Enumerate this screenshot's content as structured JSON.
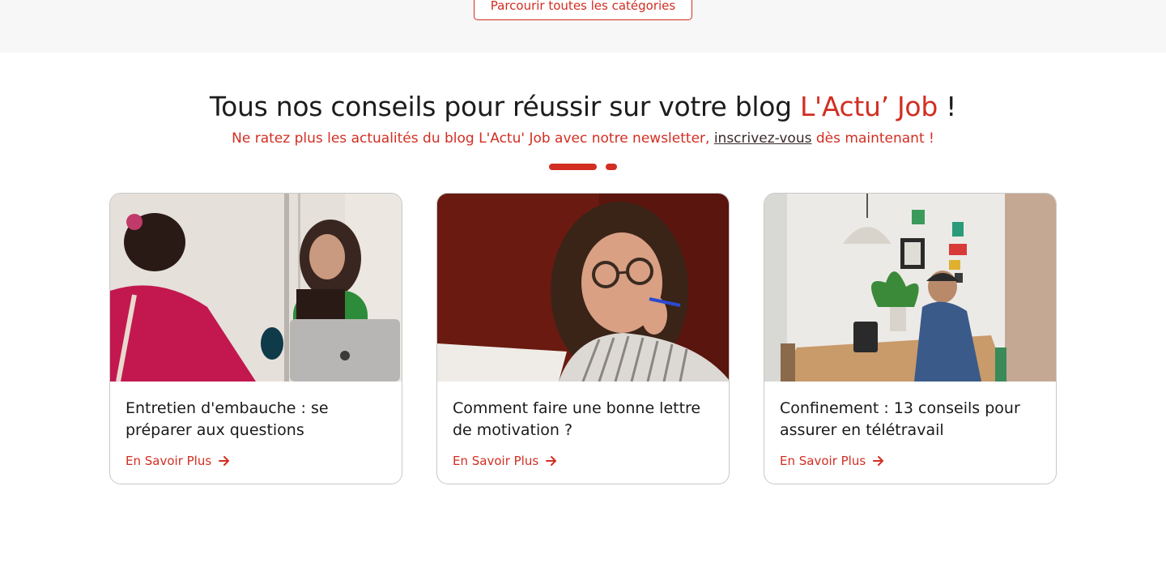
{
  "top": {
    "browse_label": "Parcourir toutes les catégories"
  },
  "section": {
    "heading_prefix": "Tous nos conseils pour réussir sur votre blog ",
    "heading_brand": "L'Actu’ Job",
    "heading_suffix": " !",
    "sub_prefix": "Ne ratez plus les actualités du blog L'Actu' Job avec notre newsletter, ",
    "sub_link": "inscrivez-vous",
    "sub_suffix": " dès maintenant  !"
  },
  "carousel": {
    "active_index": 0,
    "count": 2
  },
  "cards": [
    {
      "title": "Entretien d'embauche : se préparer aux questions",
      "more_label": "En Savoir Plus",
      "image": "two-women-interview-laptop"
    },
    {
      "title": "Comment faire une bonne lettre de motivation ?",
      "more_label": "En Savoir Plus",
      "image": "woman-with-glasses-holding-pen"
    },
    {
      "title": "Confinement : 13 conseils pour assurer en télétravail",
      "more_label": "En Savoir Plus",
      "image": "man-working-at-table-home"
    }
  ],
  "colors": {
    "accent": "#d22e22",
    "band": "#f7f7f7",
    "border": "#c8c8c8"
  },
  "icons": {
    "more": "arrow-right-icon"
  }
}
